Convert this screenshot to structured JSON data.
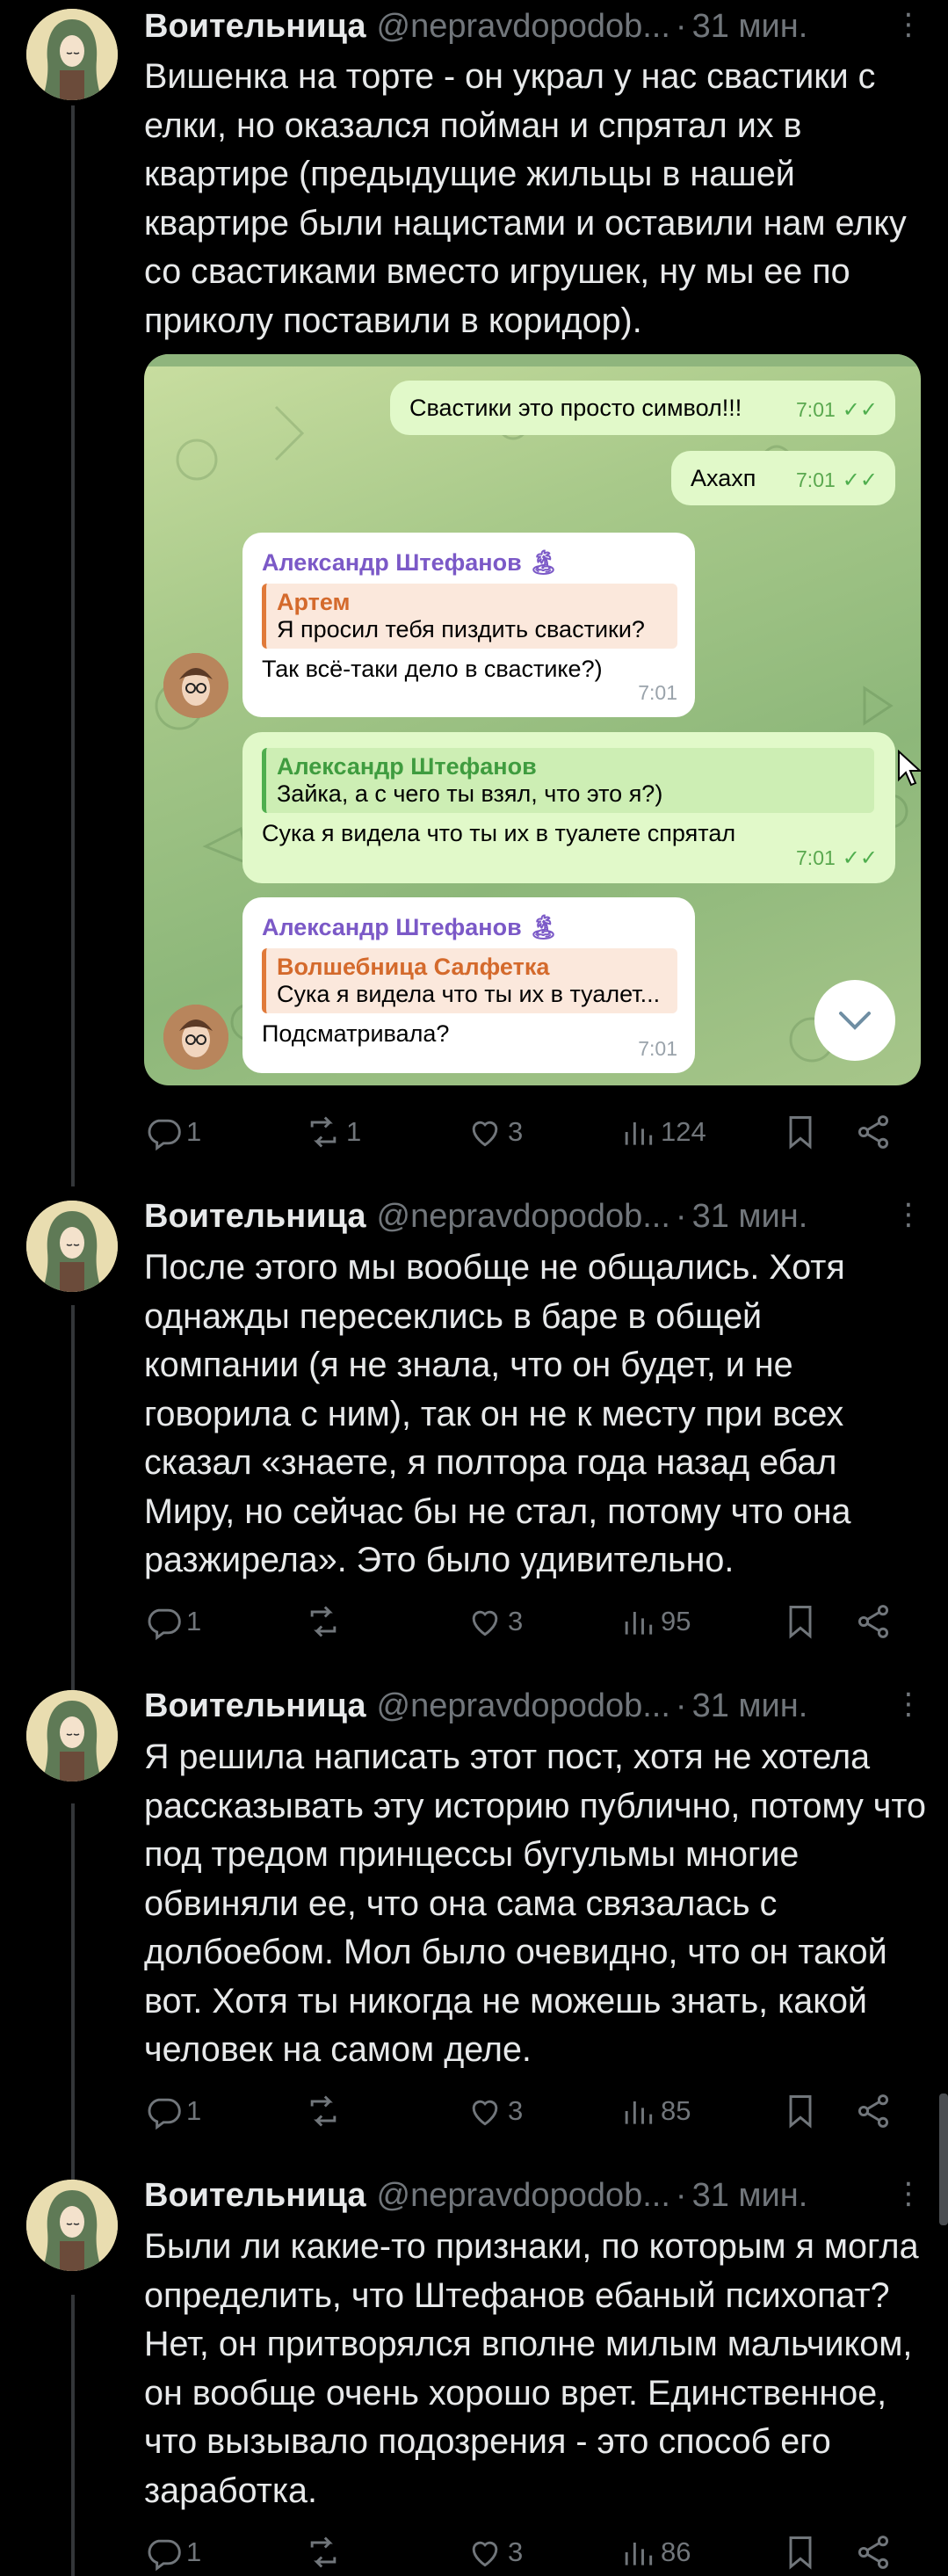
{
  "tweets": [
    {
      "name": "Воительница",
      "handle": "@nepravdopodob...",
      "time": "31 мин.",
      "text": "Вишенка на торте - он украл у нас свастики с елки, но оказался пойман и спрятал их в квартире (предыдущие жильцы в нашей квартире были нацистами и оставили нам елку со свастиками вместо игрушек, ну мы ее по приколу поставили в коридор).",
      "replies": "1",
      "retweets": "1",
      "likes": "3",
      "views": "124"
    },
    {
      "name": "Воительница",
      "handle": "@nepravdopodob...",
      "time": "31 мин.",
      "text": "После этого мы вообще не общались. Хотя однажды пересеклись в баре в общей компании (я не знала, что он будет, и не говорила с ним), так он не к месту при всех сказал «знаете, я полтора года назад ебал Миру, но сейчас бы не стал, потому что она разжирела». Это было удивительно.",
      "replies": "1",
      "retweets": "",
      "likes": "3",
      "views": "95"
    },
    {
      "name": "Воительница",
      "handle": "@nepravdopodob...",
      "time": "31 мин.",
      "text": "Я решила написать этот пост, хотя не хотела рассказывать эту историю публично, потому что под тредом принцессы бугульмы многие обвиняли ее, что она сама связалась с долбоебом. Мол было очевидно, что он такой вот. Хотя ты никогда не можешь знать, какой человек на самом деле.",
      "replies": "1",
      "retweets": "",
      "likes": "3",
      "views": "85"
    },
    {
      "name": "Воительница",
      "handle": "@nepravdopodob...",
      "time": "31 мин.",
      "text": "Были ли какие-то признаки, по которым я могла определить, что Штефанов ебаный психопат? Нет, он притворялся вполне милым мальчиком, он вообще очень хорошо врет. Единственное, что вызывало подозрения - это способ его заработка.",
      "replies": "1",
      "retweets": "",
      "likes": "3",
      "views": "86"
    }
  ],
  "telegram": {
    "msg1": {
      "text": "Свастики это просто символ!!!",
      "time": "7:01"
    },
    "msg2": {
      "text": "Ахахп",
      "time": "7:01"
    },
    "msg3": {
      "sender": "Александр Штефанов",
      "sender_emoji": "🏝",
      "quote_name": "Артем",
      "quote_text": "Я просил тебя пиздить свастики?",
      "text": "Так всё-таки дело в свастике?)",
      "time": "7:01"
    },
    "msg4": {
      "quote_name": "Александр Штефанов",
      "quote_text": "Зайка, а с чего ты взял, что это я?)",
      "text": "Сука я видела что ты их в туалете спрятал",
      "time": "7:01"
    },
    "msg5": {
      "sender": "Александр Штефанов",
      "sender_emoji": "🏝",
      "quote_name": "Волшебница Салфетка",
      "quote_text": "Сука я видела что ты их в туалет...",
      "text": "Подсматривала?",
      "time": "7:01"
    }
  },
  "icons": [
    "reply-icon",
    "retweet-icon",
    "like-icon",
    "views-icon",
    "bookmark-icon",
    "share-icon",
    "more-icon"
  ],
  "colors": {
    "background": "#000000",
    "text": "#e7e9ea",
    "muted": "#71767b",
    "thread_line": "#333639"
  }
}
